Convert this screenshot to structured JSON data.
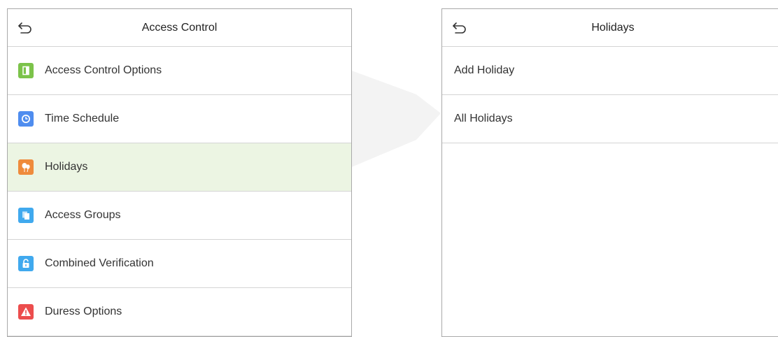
{
  "colors": {
    "selected_row": "#ecf5e3",
    "icon_green": "#7cc34a",
    "icon_blue": "#4f8def",
    "icon_orange": "#ef8b3c",
    "icon_sky": "#40a9ee",
    "icon_red": "#ec4d4d"
  },
  "left_panel": {
    "title": "Access Control",
    "items": [
      {
        "label": "Access Control Options",
        "icon": "door-icon",
        "color": "#7cc34a"
      },
      {
        "label": "Time Schedule",
        "icon": "clock-icon",
        "color": "#4f8def"
      },
      {
        "label": "Holidays",
        "icon": "balloons-icon",
        "color": "#ef8b3c",
        "selected": true
      },
      {
        "label": "Access Groups",
        "icon": "group-doors-icon",
        "color": "#40a9ee"
      },
      {
        "label": "Combined Verification",
        "icon": "unlock-icon",
        "color": "#40a9ee"
      },
      {
        "label": "Duress Options",
        "icon": "warning-icon",
        "color": "#ec4d4d"
      }
    ]
  },
  "right_panel": {
    "title": "Holidays",
    "items": [
      {
        "label": "Add Holiday"
      },
      {
        "label": "All Holidays"
      }
    ]
  }
}
